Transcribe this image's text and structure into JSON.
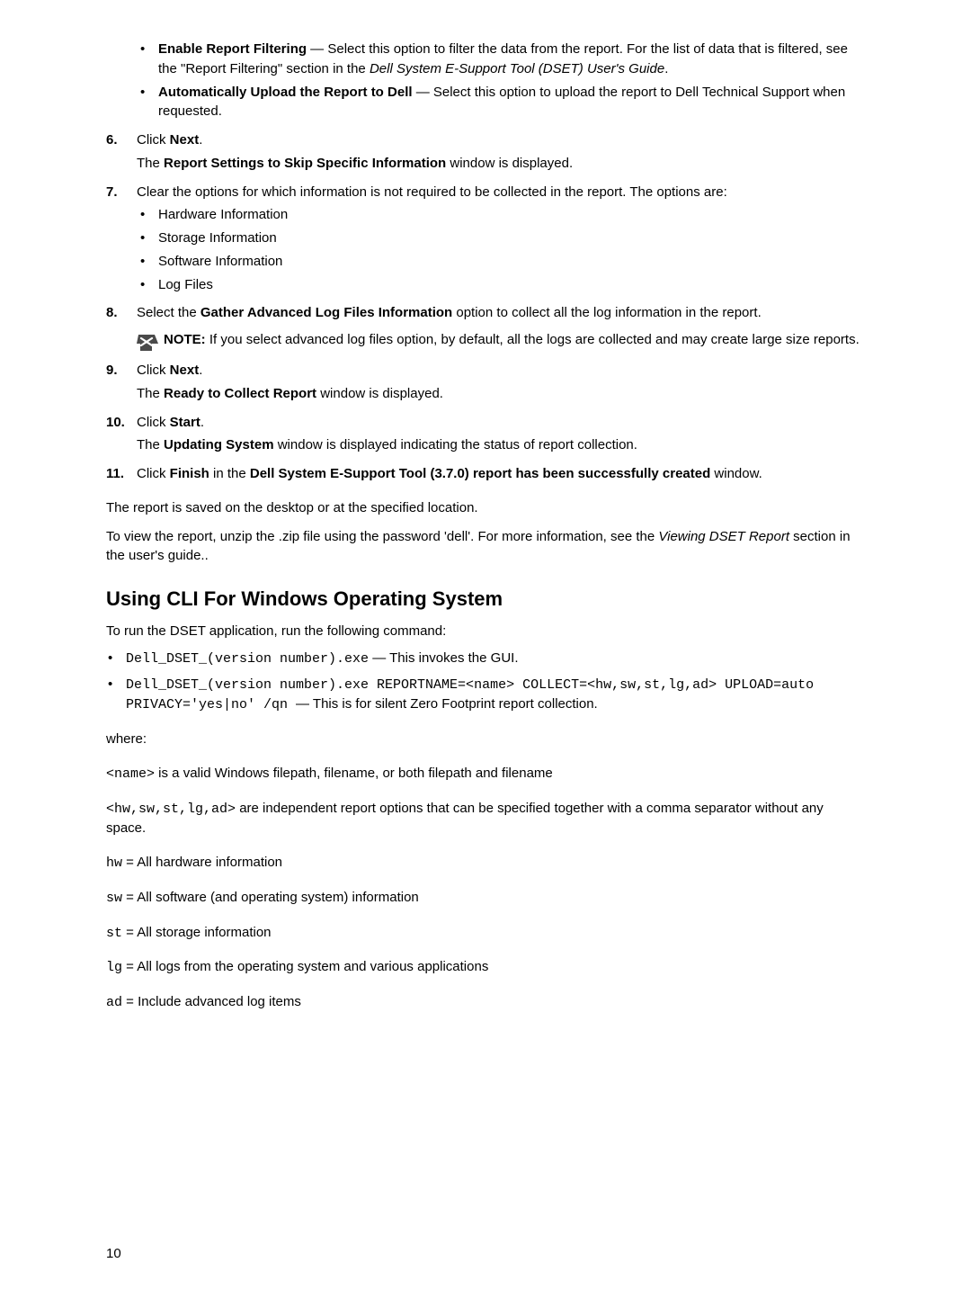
{
  "steps": {
    "s5_bullets": [
      {
        "title": "Enable Report Filtering",
        "rest_a": " — Select this option to filter the data from the report. For the list of data that is filtered, see the \"Report Filtering\" section in the ",
        "italic": "Dell System E-Support Tool (DSET) User's Guide",
        "rest_b": "."
      },
      {
        "title": "Automatically Upload the Report to Dell",
        "rest_a": " — Select this option to upload the report to Dell Technical Support when requested.",
        "italic": "",
        "rest_b": ""
      }
    ],
    "s6": {
      "num": "6.",
      "line1_a": "Click ",
      "line1_b": "Next",
      "line1_c": ".",
      "line2_a": "The ",
      "line2_b": "Report Settings to Skip Specific Information",
      "line2_c": " window is displayed."
    },
    "s7": {
      "num": "7.",
      "intro": "Clear the options for which information is not required to be collected in the report. The options are:",
      "bullets": [
        "Hardware Information",
        "Storage Information",
        "Software Information",
        "Log Files"
      ]
    },
    "s8": {
      "num": "8.",
      "a": "Select the ",
      "b": "Gather Advanced Log Files Information",
      "c": " option to collect all the log information in the report.",
      "note_bold": "NOTE: ",
      "note_rest": "If you select advanced log files option, by default, all the logs are collected and may create large size reports."
    },
    "s9": {
      "num": "9.",
      "l1a": "Click ",
      "l1b": "Next",
      "l1c": ".",
      "l2a": "The ",
      "l2b": "Ready to Collect Report",
      "l2c": " window is displayed."
    },
    "s10": {
      "num": "10.",
      "l1a": "Click ",
      "l1b": "Start",
      "l1c": ".",
      "l2a": "The ",
      "l2b": "Updating System",
      "l2c": " window is displayed indicating the status of report collection."
    },
    "s11": {
      "num": "11.",
      "a": "Click ",
      "b": "Finish",
      "c": " in the ",
      "d": "Dell System E-Support Tool (3.7.0) report has been successfully created",
      "e": " window."
    }
  },
  "para1": "The report is saved on the desktop or at the specified location.",
  "para2_a": "To view the report, unzip the .zip file using the password 'dell'. For more information, see the ",
  "para2_i": "Viewing DSET Report",
  "para2_b": " section in the user's guide..",
  "h2": "Using CLI For Windows Operating System",
  "cli_intro": "To run the DSET application, run the following command:",
  "cli_bullets": [
    {
      "code": "Dell_DSET_(version number).exe",
      "rest": " — This invokes the GUI."
    },
    {
      "code": "Dell_DSET_(version number).exe REPORTNAME=<name> COLLECT=<hw,sw,st,lg,ad> UPLOAD=auto PRIVACY='yes|no' /qn ",
      "rest": " — This is for silent Zero Footprint report collection."
    }
  ],
  "where_label": "where:",
  "defs": {
    "name_code": "<name>",
    "name_rest": " is a valid Windows filepath, filename, or both filepath and filename",
    "opts_code": "<hw,sw,st,lg,ad>",
    "opts_rest": " are independent report options that can be specified together with a comma separator without any space.",
    "hw_code": "hw",
    "hw_rest": " = All hardware information",
    "sw_code": "sw",
    "sw_rest": " = All software (and operating system) information",
    "st_code": "st",
    "st_rest": " = All storage information",
    "lg_code": "lg",
    "lg_rest": " = All logs from the operating system and various applications",
    "ad_code": "ad",
    "ad_rest": " = Include advanced log items"
  },
  "page_number": "10"
}
